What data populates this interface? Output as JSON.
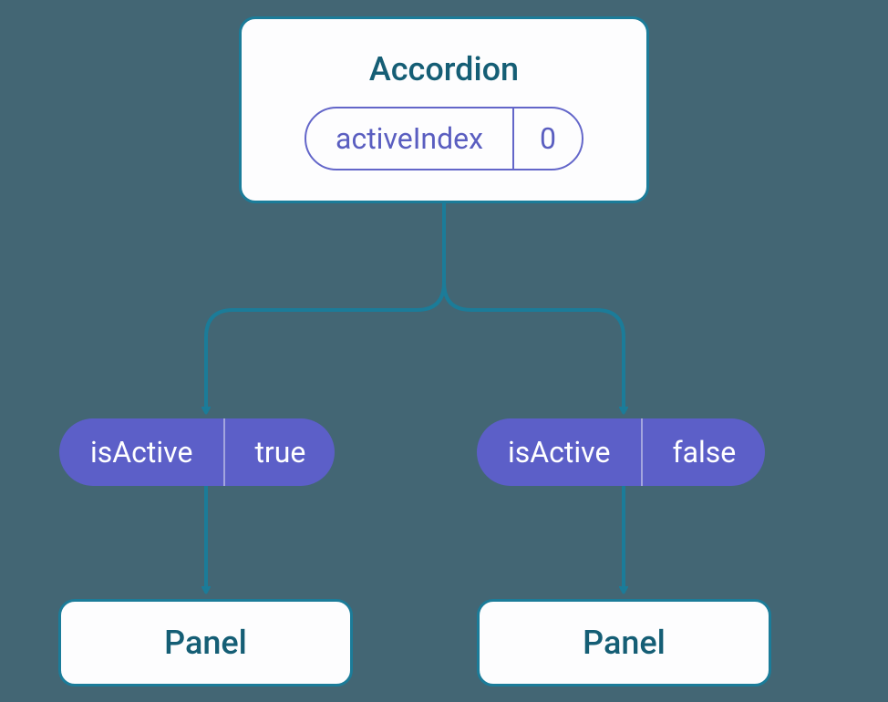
{
  "accordion": {
    "title": "Accordion",
    "state_name": "activeIndex",
    "state_value": "0"
  },
  "props": {
    "left": {
      "name": "isActive",
      "value": "true"
    },
    "right": {
      "name": "isActive",
      "value": "false"
    }
  },
  "panels": {
    "left": "Panel",
    "right": "Panel"
  },
  "colors": {
    "background": "#436674",
    "box_border": "#1b7c99",
    "text_teal": "#155e75",
    "pill_purple_bg": "#5c5fc8",
    "pill_purple_border": "#6366c9"
  }
}
